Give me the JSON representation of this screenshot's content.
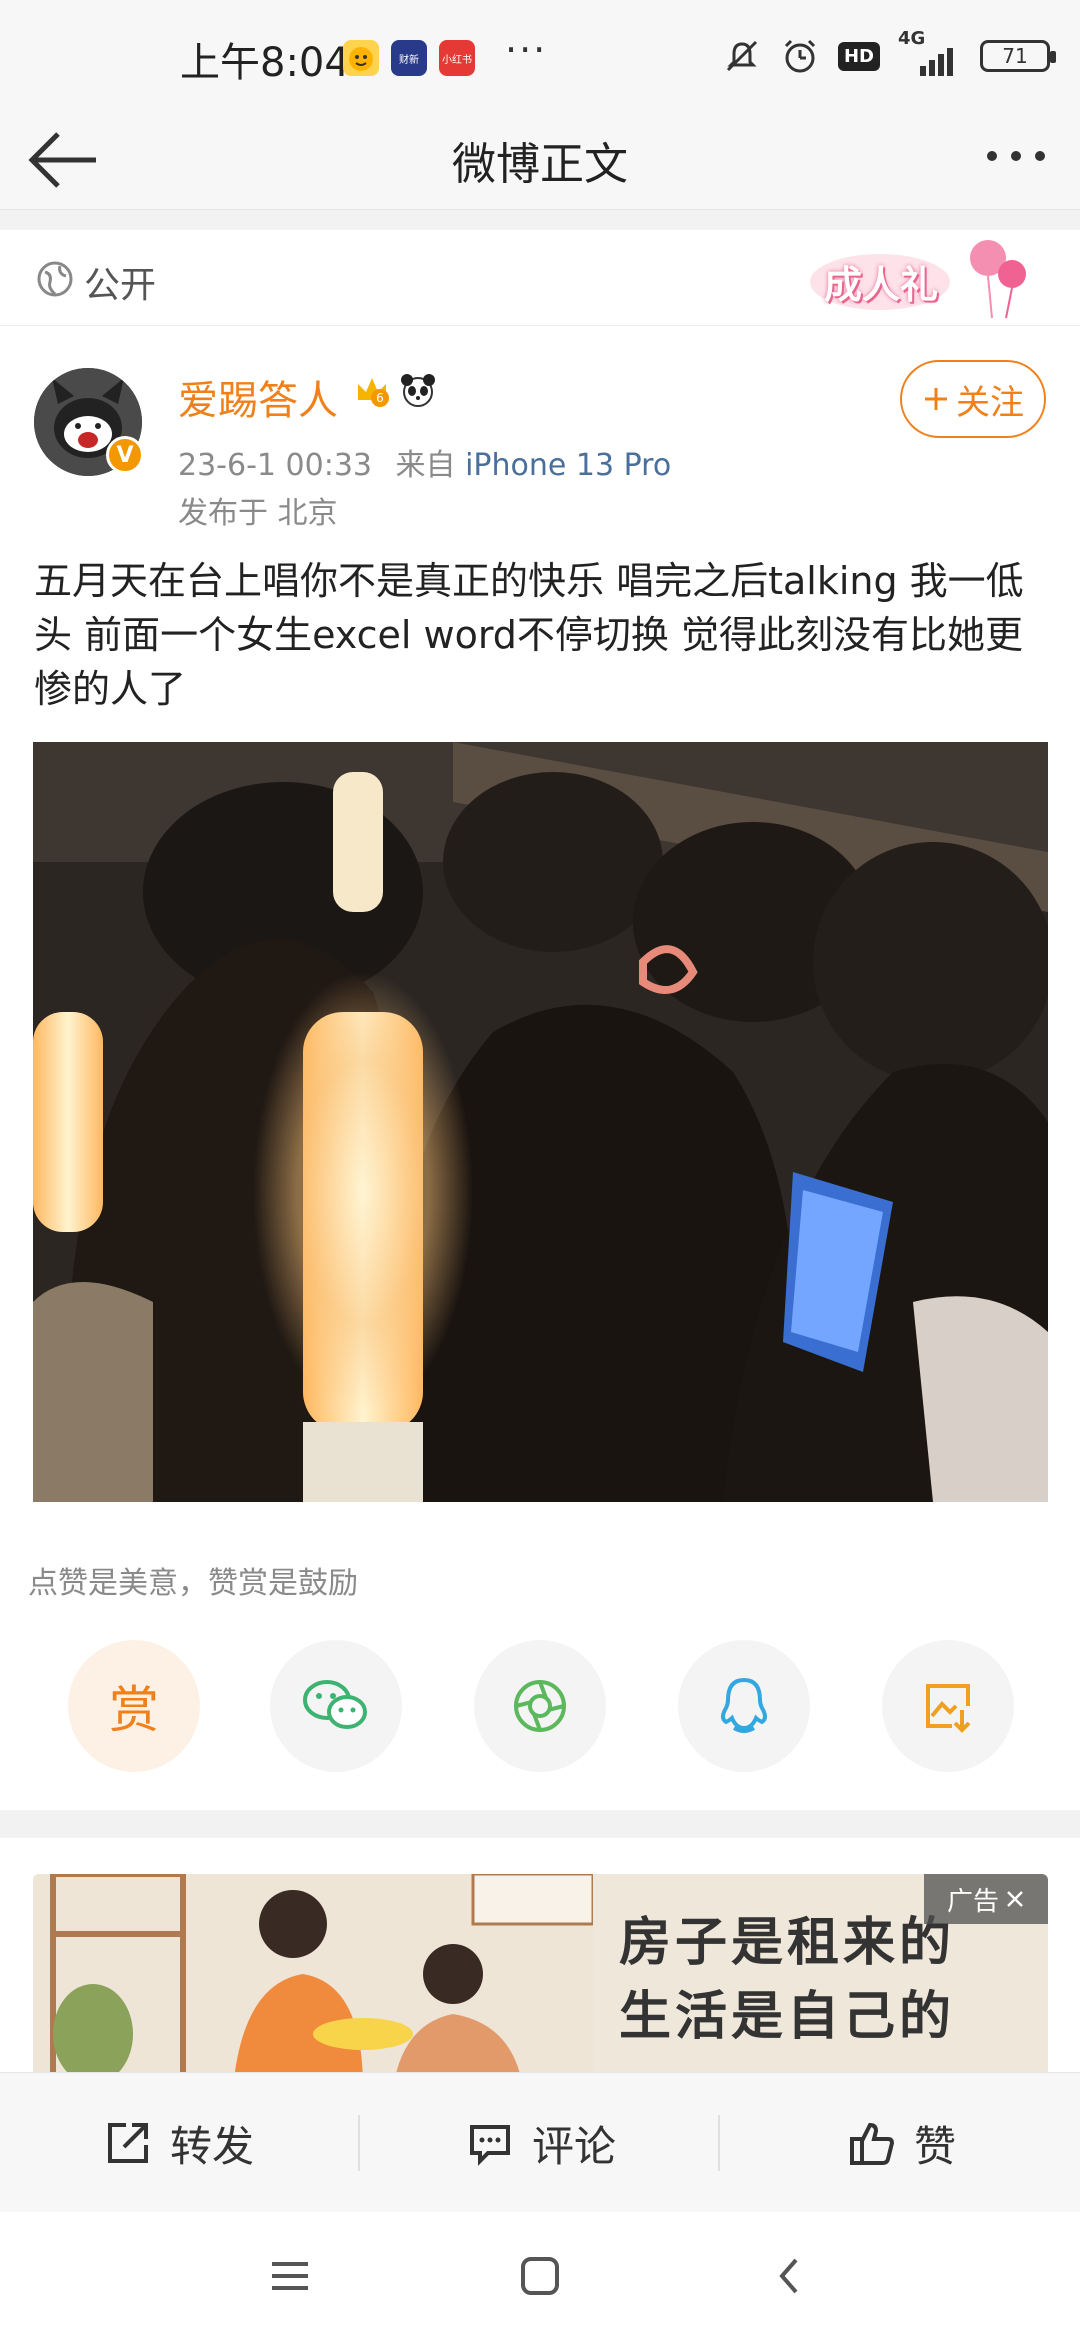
{
  "status": {
    "time": "上午8:04",
    "apps": [
      {
        "name": "emoji-app",
        "color": "#ffd34d",
        "label": ""
      },
      {
        "name": "news-app",
        "color": "#2a3a8a",
        "label": "财新"
      },
      {
        "name": "red-app",
        "color": "#e53935",
        "label": "小红书"
      }
    ],
    "more": "···",
    "hd": "HD",
    "net": "4G",
    "battery": "71"
  },
  "nav": {
    "title": "微博正文"
  },
  "post": {
    "visibility": "公开",
    "badge": "成人礼",
    "username": "爱踢答人",
    "follow_label": "关注",
    "date": "23-6-1 00:33",
    "from_label": "来自",
    "source": "iPhone 13 Pro",
    "location": "发布于 北京",
    "text": "五月天在台上唱你不是真正的快乐 唱完之后talking 我一低头 前面一个女生excel word不停切换 觉得此刻没有比她更惨的人了",
    "reward_hint": "点赞是美意，赞赏是鼓励",
    "reward_label": "赏"
  },
  "ad": {
    "tag": "广告",
    "line1": "房子是租来的",
    "line2": "生活是自己的"
  },
  "actions": {
    "repost": "转发",
    "comment": "评论",
    "like": "赞"
  },
  "colors": {
    "accent": "#f0811a",
    "link": "#4a6f9a"
  }
}
